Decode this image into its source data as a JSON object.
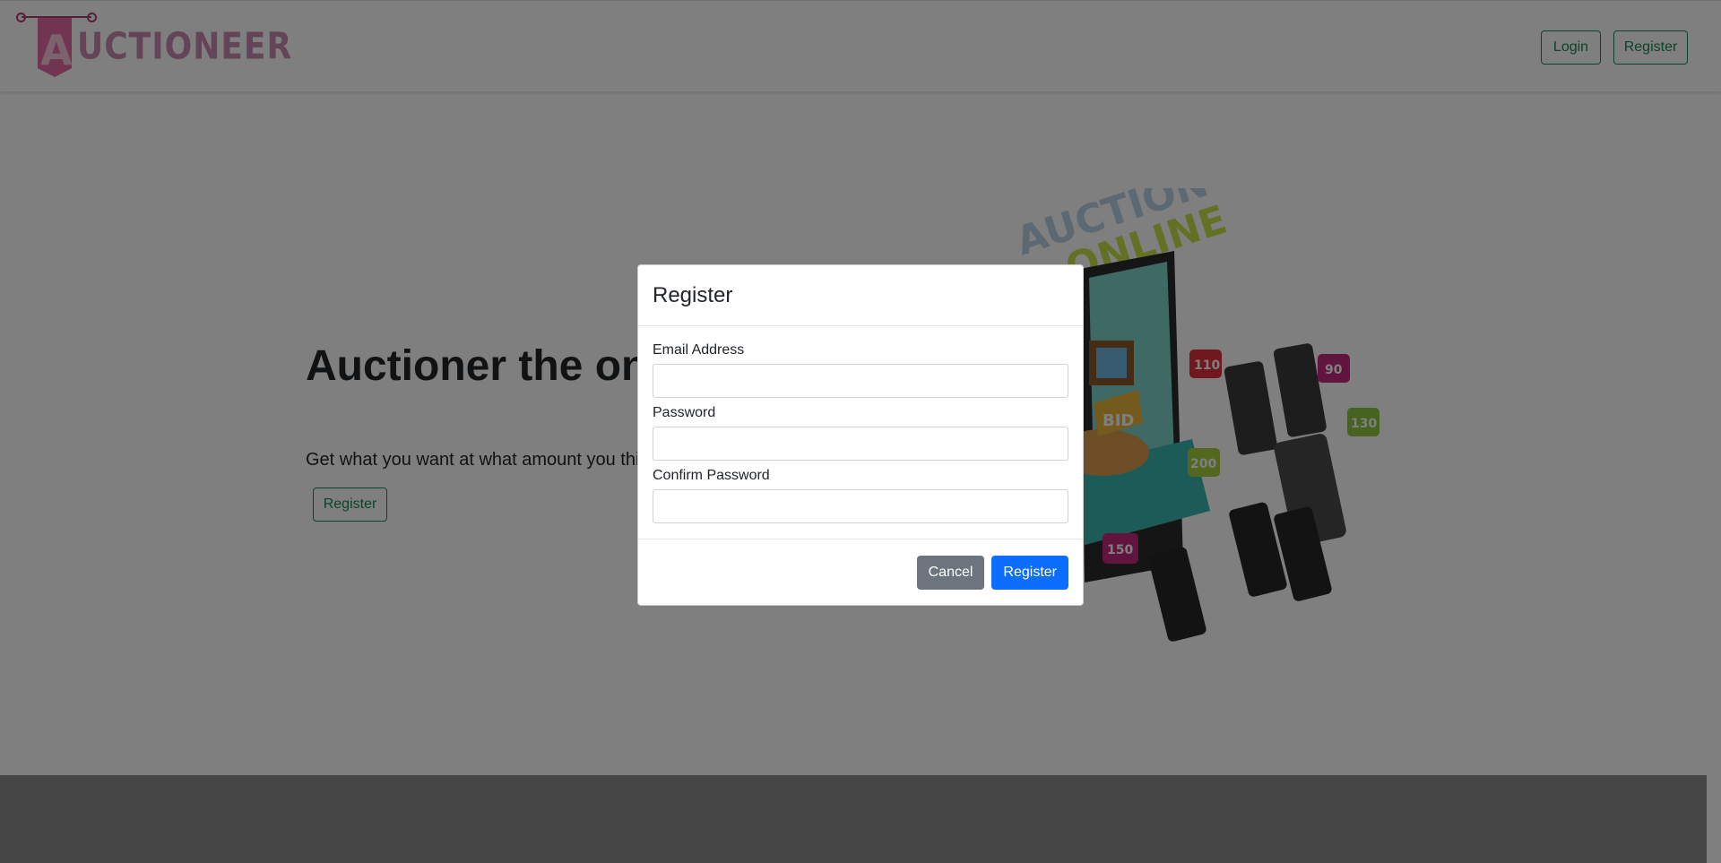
{
  "navbar": {
    "logo_text": "AUCTIONEER",
    "login_label": "Login",
    "register_label": "Register"
  },
  "hero": {
    "title": "Auctioner the online way to place bid",
    "subtitle": "Get what you want at what amount you think is worth it.",
    "register_label": "Register",
    "illustration": {
      "sign_top": "AUCTION",
      "sign_bottom": "ONLINE",
      "easel_label": "BID",
      "bubbles": [
        "110",
        "90",
        "130",
        "200",
        "150"
      ]
    }
  },
  "modal": {
    "title": "Register",
    "email_label": "Email Address",
    "email_value": "",
    "password_label": "Password",
    "password_value": "",
    "confirm_label": "Confirm Password",
    "confirm_value": "",
    "cancel_label": "Cancel",
    "submit_label": "Register"
  },
  "colors": {
    "brand_pink": "#e26aa5",
    "outline_green": "#198754",
    "primary_blue": "#0d6efd",
    "secondary_gray": "#6c757d",
    "backdrop": "rgba(0,0,0,0.5)"
  }
}
